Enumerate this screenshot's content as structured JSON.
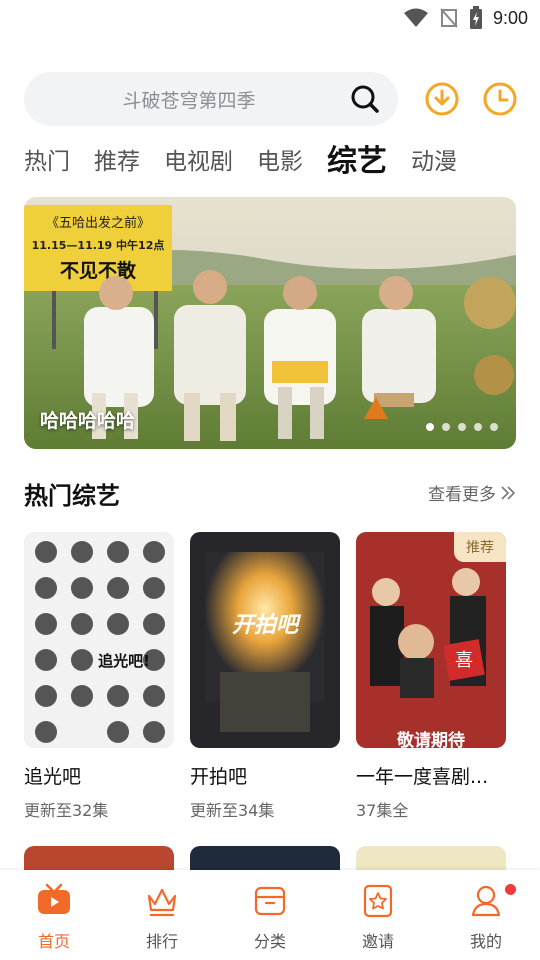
{
  "status_bar": {
    "time": "9:00"
  },
  "search": {
    "placeholder": "斗破苍穹第四季"
  },
  "tabs": [
    {
      "label": "热门",
      "active": false
    },
    {
      "label": "推荐",
      "active": false
    },
    {
      "label": "电视剧",
      "active": false
    },
    {
      "label": "电影",
      "active": false
    },
    {
      "label": "综艺",
      "active": true
    },
    {
      "label": "动漫",
      "active": false
    }
  ],
  "banner": {
    "caption": "哈哈哈哈哈",
    "sign_line1": "《五哈出发之前》",
    "sign_line2": "11.15—11.19 中午12点",
    "sign_line3": "不见不散",
    "slide_count": 5,
    "active_slide": 1
  },
  "section": {
    "title": "热门综艺",
    "more_label": "查看更多"
  },
  "cards": [
    {
      "title": "追光吧",
      "subtitle": "更新至32集",
      "poster_text": "追光吧!",
      "badge": ""
    },
    {
      "title": "开拍吧",
      "subtitle": "更新至34集",
      "poster_text": "开拍吧",
      "badge": ""
    },
    {
      "title": "一年一度喜剧...",
      "subtitle": "37集全",
      "poster_text": "敬请期待",
      "badge": "推荐"
    }
  ],
  "bottom_nav": [
    {
      "label": "首页",
      "icon": "tv-icon",
      "active": true
    },
    {
      "label": "排行",
      "icon": "crown-icon",
      "active": false
    },
    {
      "label": "分类",
      "icon": "box-icon",
      "active": false
    },
    {
      "label": "邀请",
      "icon": "star-doc-icon",
      "active": false
    },
    {
      "label": "我的",
      "icon": "user-icon",
      "active": false,
      "dot": true
    }
  ],
  "colors": {
    "accent": "#f26a2a",
    "download": "#f5a623",
    "history": "#f5a623",
    "badge_bg": "#f6e4c4"
  }
}
